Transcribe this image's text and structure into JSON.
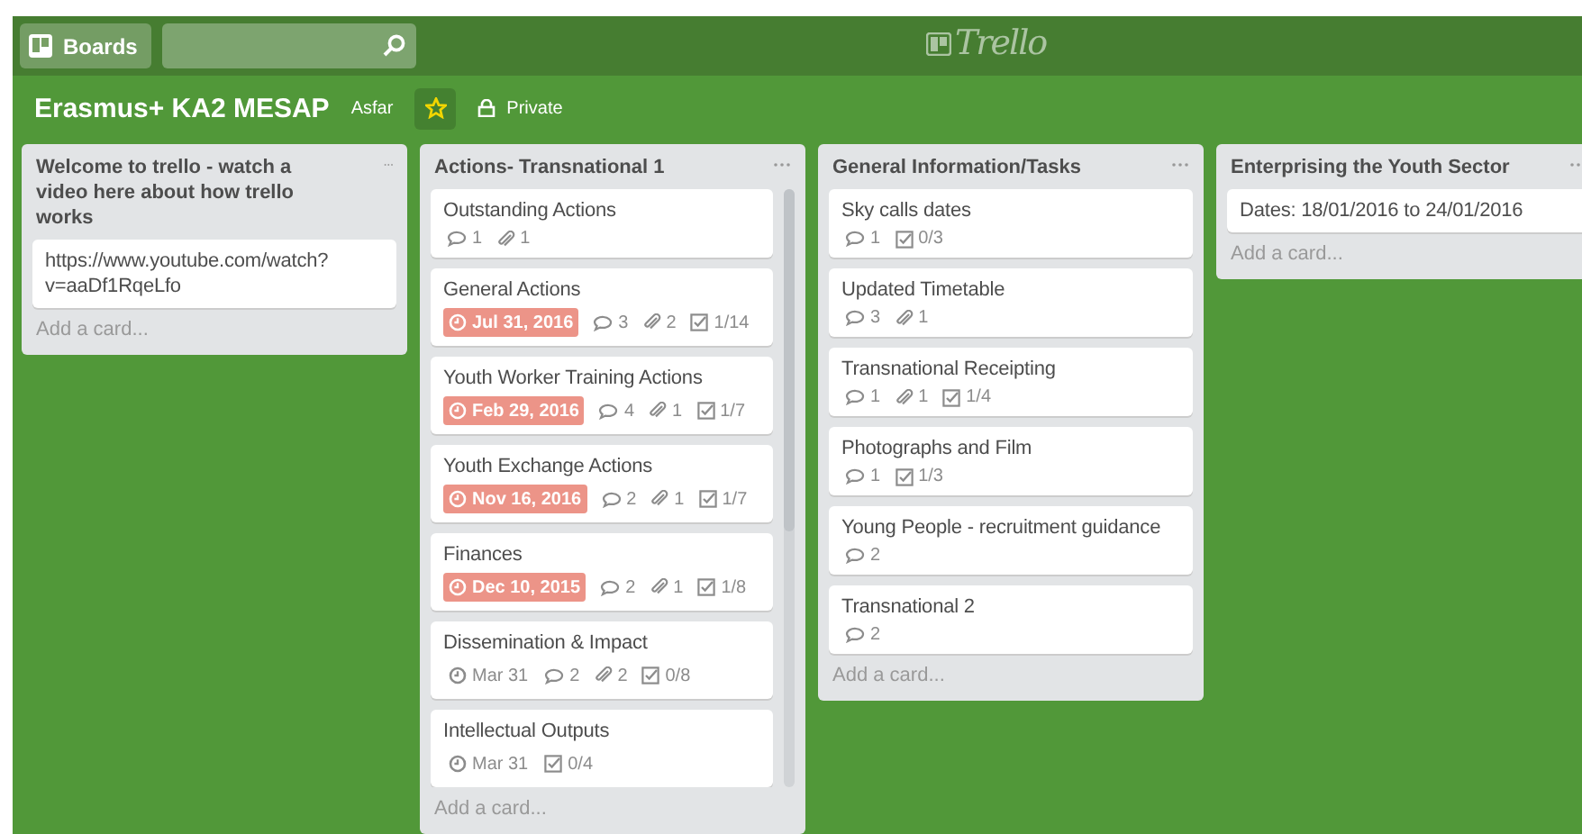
{
  "header": {
    "boards_button": "Boards",
    "logo": "Trello"
  },
  "board": {
    "title": "Erasmus+ KA2 MESAP",
    "team": "Asfar",
    "starred": true,
    "visibility": "Private"
  },
  "lists": [
    {
      "title": "Welcome to trello - watch a video here about how trello works",
      "scrollbar": false,
      "cards": [
        {
          "title": "https://www.youtube.com/watch?v=aaDf1RqeLfo"
        }
      ],
      "add_card": "Add a card..."
    },
    {
      "title": "Actions- Transnational 1",
      "scrollbar": true,
      "cards": [
        {
          "title": "Outstanding Actions",
          "badges": [
            {
              "kind": "comments",
              "text": "1"
            },
            {
              "kind": "attachments",
              "text": "1"
            }
          ]
        },
        {
          "title": "General Actions",
          "badges": [
            {
              "kind": "due",
              "text": "Jul 31, 2016",
              "overdue": true
            },
            {
              "kind": "comments",
              "text": "3"
            },
            {
              "kind": "attachments",
              "text": "2"
            },
            {
              "kind": "checklist",
              "text": "1/14"
            }
          ]
        },
        {
          "title": "Youth Worker Training Actions",
          "badges": [
            {
              "kind": "due",
              "text": "Feb 29, 2016",
              "overdue": true
            },
            {
              "kind": "comments",
              "text": "4"
            },
            {
              "kind": "attachments",
              "text": "1"
            },
            {
              "kind": "checklist",
              "text": "1/7"
            }
          ]
        },
        {
          "title": "Youth Exchange Actions",
          "badges": [
            {
              "kind": "due",
              "text": "Nov 16, 2016",
              "overdue": true
            },
            {
              "kind": "comments",
              "text": "2"
            },
            {
              "kind": "attachments",
              "text": "1"
            },
            {
              "kind": "checklist",
              "text": "1/7"
            }
          ]
        },
        {
          "title": "Finances",
          "badges": [
            {
              "kind": "due",
              "text": "Dec 10, 2015",
              "overdue": true
            },
            {
              "kind": "comments",
              "text": "2"
            },
            {
              "kind": "attachments",
              "text": "1"
            },
            {
              "kind": "checklist",
              "text": "1/8"
            }
          ]
        },
        {
          "title": "Dissemination & Impact",
          "badges": [
            {
              "kind": "due",
              "text": "Mar 31",
              "overdue": false
            },
            {
              "kind": "comments",
              "text": "2"
            },
            {
              "kind": "attachments",
              "text": "2"
            },
            {
              "kind": "checklist",
              "text": "0/8"
            }
          ]
        },
        {
          "title": "Intellectual Outputs",
          "badges": [
            {
              "kind": "due",
              "text": "Mar 31",
              "overdue": false
            },
            {
              "kind": "checklist",
              "text": "0/4"
            }
          ]
        }
      ],
      "add_card": "Add a card..."
    },
    {
      "title": "General Information/Tasks",
      "scrollbar": false,
      "cards": [
        {
          "title": "Sky calls dates",
          "badges": [
            {
              "kind": "comments",
              "text": "1"
            },
            {
              "kind": "checklist",
              "text": "0/3"
            }
          ]
        },
        {
          "title": "Updated Timetable",
          "badges": [
            {
              "kind": "comments",
              "text": "3"
            },
            {
              "kind": "attachments",
              "text": "1"
            }
          ]
        },
        {
          "title": "Transnational Receipting",
          "badges": [
            {
              "kind": "comments",
              "text": "1"
            },
            {
              "kind": "attachments",
              "text": "1"
            },
            {
              "kind": "checklist",
              "text": "1/4"
            }
          ]
        },
        {
          "title": "Photographs and Film",
          "badges": [
            {
              "kind": "comments",
              "text": "1"
            },
            {
              "kind": "checklist",
              "text": "1/3"
            }
          ]
        },
        {
          "title": "Young People - recruitment guidance",
          "badges": [
            {
              "kind": "comments",
              "text": "2"
            }
          ]
        },
        {
          "title": "Transnational 2",
          "badges": [
            {
              "kind": "comments",
              "text": "2"
            }
          ]
        }
      ],
      "add_card": "Add a card..."
    },
    {
      "title": "Enterprising the Youth Sector",
      "scrollbar": false,
      "cards": [
        {
          "title": "Dates: 18/01/2016 to 24/01/2016"
        }
      ],
      "add_card": "Add a card..."
    }
  ]
}
